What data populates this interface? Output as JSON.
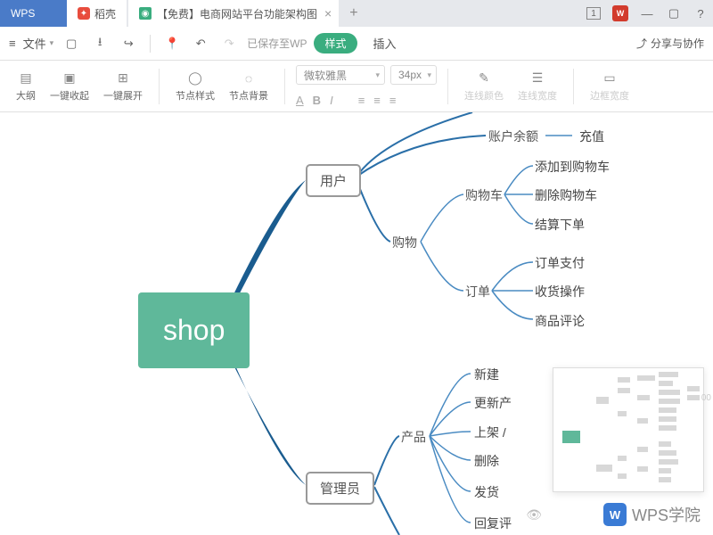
{
  "titlebar": {
    "wps": "WPS",
    "docer": "稻壳",
    "doc_title": "【免费】电商网站平台功能架构图",
    "win_number": "1"
  },
  "menubar": {
    "file": "文件",
    "save_status": "已保存至WP",
    "style": "样式",
    "insert": "插入",
    "share": "分享与协作"
  },
  "toolbar": {
    "outline": "大纲",
    "collapse_all": "一键收起",
    "expand_all": "一键展开",
    "node_style": "节点样式",
    "node_bg": "节点背景",
    "font_name": "微软雅黑",
    "font_size": "34px",
    "line_color": "连线颜色",
    "line_width": "连线宽度",
    "border_width": "边框宽度"
  },
  "mindmap": {
    "root": "shop",
    "user": "用户",
    "admin": "管理员",
    "balance": "账户余额",
    "recharge": "充值",
    "shopping": "购物",
    "cart": "购物车",
    "cart_add": "添加到购物车",
    "cart_del": "删除购物车",
    "cart_checkout": "结算下单",
    "order": "订单",
    "order_pay": "订单支付",
    "order_receive": "收货操作",
    "order_review": "商品评论",
    "product": "产品",
    "prod_new": "新建",
    "prod_update": "更新产",
    "prod_shelf": "上架 / ",
    "prod_delete": "删除",
    "ship": "发货",
    "reply": "回复评"
  },
  "watermark": "WPS学院",
  "zoom": "00"
}
